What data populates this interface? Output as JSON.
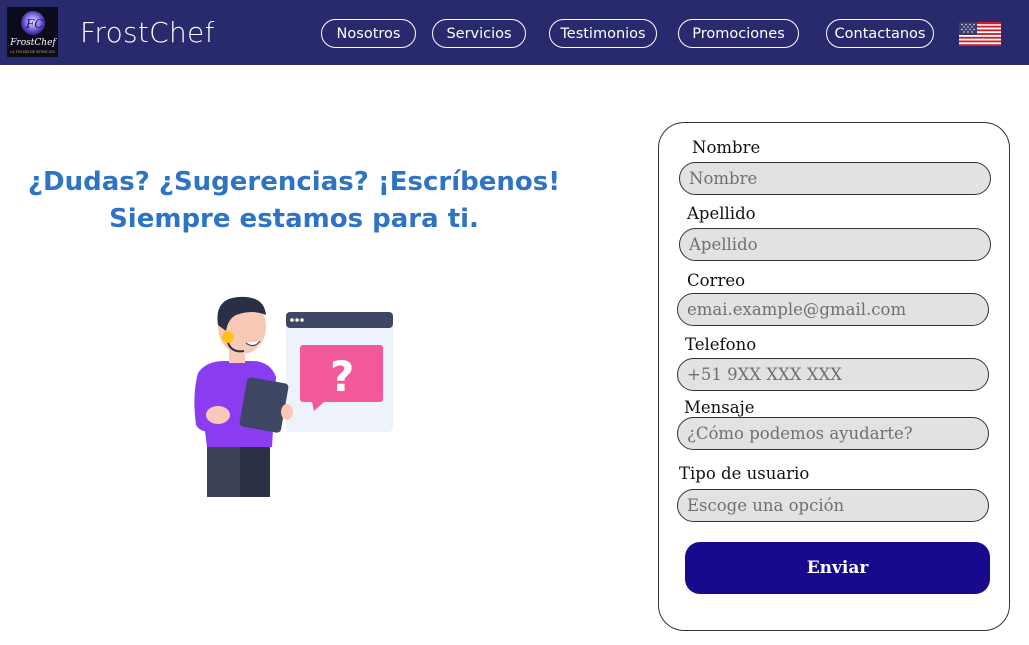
{
  "header": {
    "logo_text": "FrostChef",
    "logo_tagline": "LA FUSIÓN DE SERVICIOS",
    "brand": "FrostChef",
    "nav": [
      {
        "label": "Nosotros"
      },
      {
        "label": "Servicios"
      },
      {
        "label": "Testimonios"
      },
      {
        "label": "Promociones"
      },
      {
        "label": "Contactanos"
      }
    ],
    "language_flag": "us-flag-icon"
  },
  "hero": {
    "line1": "¿Dudas? ¿Sugerencias? ¡Escríbenos!",
    "line2": "Siempre estamos para ti.",
    "illustration": "support-agent-illustration"
  },
  "form": {
    "fields": [
      {
        "label": "Nombre",
        "placeholder": "Nombre"
      },
      {
        "label": "Apellido",
        "placeholder": "Apellido"
      },
      {
        "label": "Correo",
        "placeholder": "emai.example@gmail.com"
      },
      {
        "label": "Telefono",
        "placeholder": "+51 9XX XXX XXX"
      },
      {
        "label": "Mensaje",
        "placeholder": "¿Cómo podemos ayudarte?"
      },
      {
        "label": "Tipo de usuario",
        "placeholder": "Escoge una opción"
      }
    ],
    "submit_label": "Enviar"
  },
  "colors": {
    "header_bg": "#29296e",
    "headline": "#2f73c5",
    "submit_bg": "#170a8c",
    "input_bg": "#e2e2e2"
  }
}
